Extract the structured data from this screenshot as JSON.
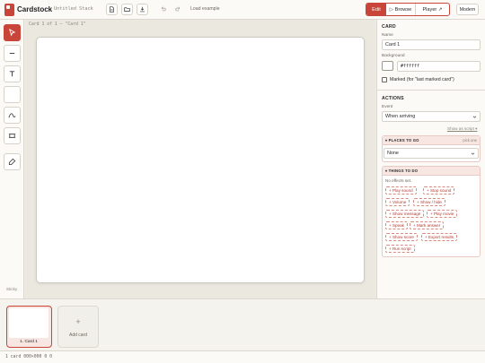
{
  "app": {
    "title": "Cardstock",
    "stack_name": "Untitled Stack"
  },
  "toolbar": {
    "new_icon": "file-icon",
    "open_icon": "folder-icon",
    "save_icon": "download-icon",
    "undo_icon": "undo-icon",
    "redo_icon": "redo-icon",
    "load_example": "Load example",
    "modes": {
      "edit": "Edit",
      "browse": "▷ Browse",
      "player": "Player ↗"
    },
    "theme": "Modern"
  },
  "rail": {
    "tools": [
      "pointer-icon",
      "line-icon",
      "text-icon",
      "rectangle-icon",
      "path-icon",
      "frame-icon",
      "eraser-icon"
    ],
    "bottom_label": "Sticky"
  },
  "canvas": {
    "caption": "Card 1 of 1 — \"Card 1\""
  },
  "inspector": {
    "card_title": "CARD",
    "name_label": "Name",
    "name_value": "Card 1",
    "background_label": "Background",
    "background_value": "#ffffff",
    "marked_label": "Marked (for \"last marked card\")",
    "actions_title": "ACTIONS",
    "event_label": "Event",
    "event_value": "When arriving",
    "show_script": "Show as script ▾",
    "places_title": "▾ PLACES TO GO",
    "places_right": "pick one",
    "places_value": "None",
    "things_title": "▾ THINGS TO DO",
    "no_effects": "No effects set.",
    "chips": [
      "+ Play sound",
      "+ Stop sound",
      "+ Volume",
      "+ Show / hide",
      "+ Show message",
      "+ Play movie",
      "+ Speak",
      "+ Mark answer",
      "+ Show score",
      "+ Export results",
      "+ Run script"
    ]
  },
  "cards": {
    "thumb_label": "1. Card 1",
    "add_plus": "+",
    "add_label": "Add card"
  },
  "status": {
    "text": "1 card  000×000  0 0"
  },
  "colors": {
    "accent": "#c9453a",
    "background": "#efede6"
  }
}
